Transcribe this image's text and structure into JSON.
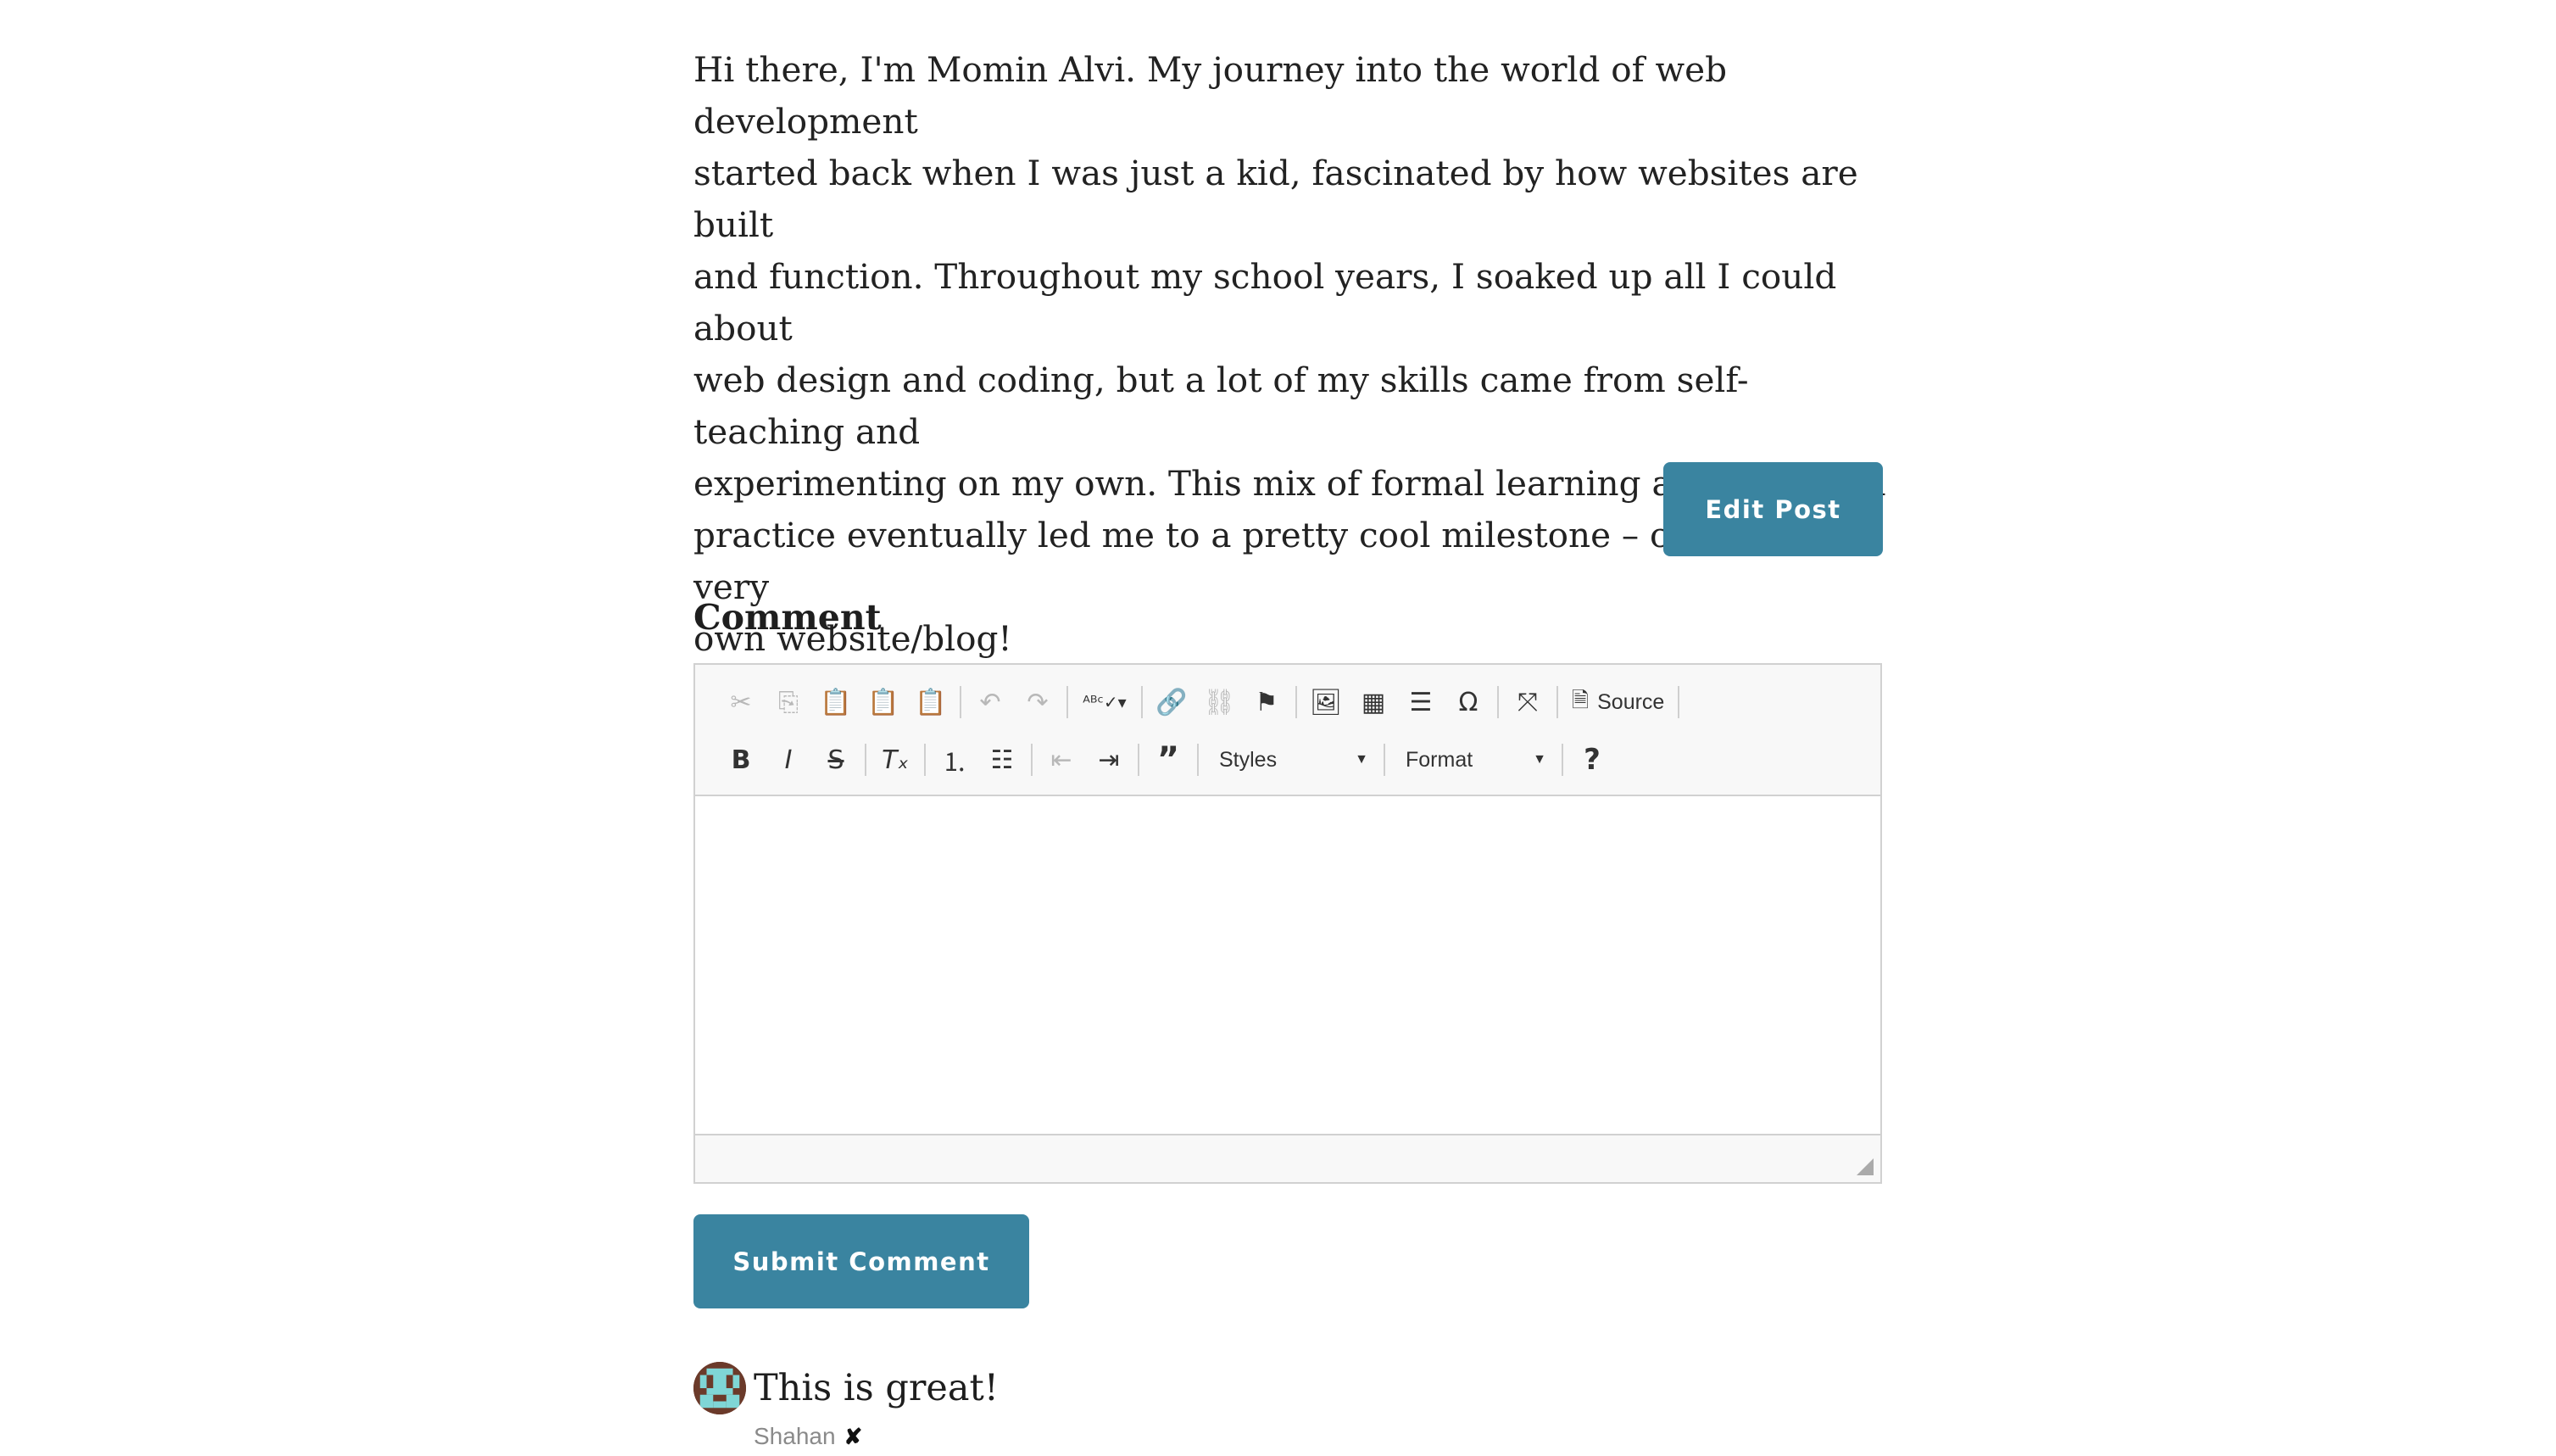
{
  "post": {
    "lines": [
      "Hi there, I'm Momin Alvi. My journey into the world of web development",
      "started back when I was just a kid, fascinated by how websites are built",
      "and function. Throughout my school years, I soaked up all I could about",
      "web design and coding, but a lot of my skills came from self-teaching and",
      "experimenting on my own. This mix of formal learning and hands-on",
      "practice eventually led me to a pretty cool milestone – creating my very",
      "own website/blog!"
    ],
    "edit_label": "Edit Post"
  },
  "comment_form": {
    "heading": "Comment",
    "toolbar": {
      "source_label": "Source",
      "styles_label": "Styles",
      "format_label": "Format",
      "help_label": "?"
    },
    "submit_label": "Submit Comment"
  },
  "comments": [
    {
      "text": "This is great!",
      "author": "Shahan",
      "delete_glyph": "✘"
    }
  ],
  "colors": {
    "accent": "#3a84a0",
    "avatar_bg": "#6b3a2a",
    "avatar_fg": "#7fd6d6"
  }
}
